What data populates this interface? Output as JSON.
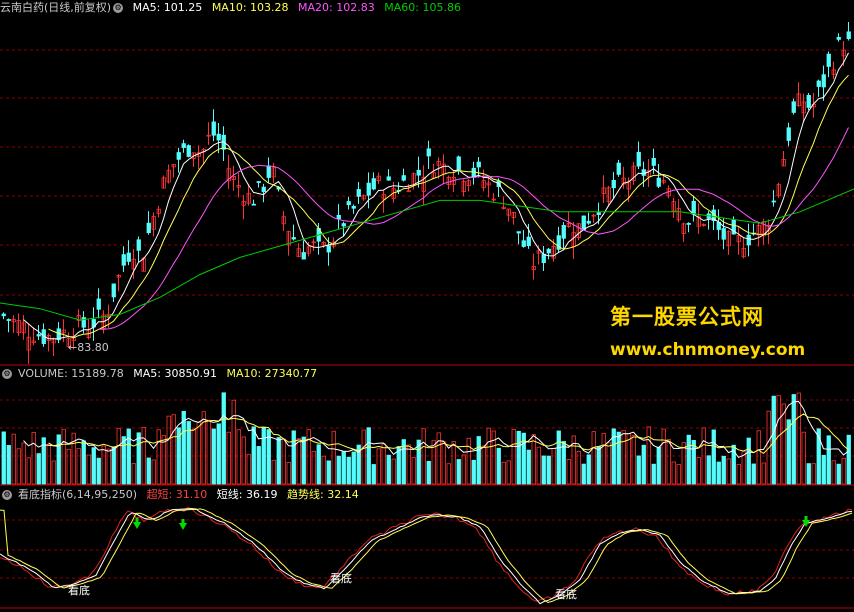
{
  "price_header": {
    "title": "云南白药(日线,前复权)",
    "ma5": "MA5: 101.25",
    "ma10": "MA10: 103.28",
    "ma20": "MA20: 102.83",
    "ma60": "MA60: 105.86"
  },
  "volume_header": {
    "title": "VOLUME: 15189.78",
    "ma5": "MA5: 30850.91",
    "ma10": "MA10: 27340.77"
  },
  "indicator_header": {
    "title": "看底指标(6,14,95,250)",
    "chao_label": "超短:",
    "chao_value": "31.10",
    "short_label": "短线:",
    "short_value": "36.19",
    "trend_label": "趋势线:",
    "trend_value": "32.14"
  },
  "low_marker": "83.80",
  "watermark": {
    "name": "第一股票公式网",
    "url": "www.chnmoney.com"
  },
  "bottom_marks": [
    "看底",
    "看底",
    "看底"
  ],
  "colors": {
    "up": "#ff3232",
    "down": "#54fcfc",
    "ma5": "#ffffff",
    "ma10": "#ffff55",
    "ma20": "#ff55ff",
    "ma60": "#00cc00",
    "grid": "#8b0000",
    "separator": "#c00000",
    "header_text": "#c8c8c8",
    "watermark": "#ffd700",
    "arrow": "#00dd00"
  },
  "chart_data": [
    {
      "type": "candlestick",
      "title": "云南白药(日线,前复权)",
      "series": [
        {
          "name": "MA5",
          "last": 101.25
        },
        {
          "name": "MA10",
          "last": 103.28
        },
        {
          "name": "MA20",
          "last": 102.83
        },
        {
          "name": "MA60",
          "last": 105.86
        }
      ],
      "annotations": [
        "83.80"
      ],
      "close_path": [
        [
          0,
          88
        ],
        [
          10,
          87
        ],
        [
          20,
          86
        ],
        [
          30,
          85
        ],
        [
          45,
          84
        ],
        [
          55,
          84.5
        ],
        [
          65,
          85
        ],
        [
          75,
          86
        ],
        [
          85,
          86
        ],
        [
          95,
          87
        ],
        [
          105,
          88
        ],
        [
          112,
          92
        ],
        [
          120,
          96
        ],
        [
          130,
          100
        ],
        [
          140,
          98
        ],
        [
          150,
          104
        ],
        [
          160,
          110
        ],
        [
          170,
          114
        ],
        [
          180,
          116
        ],
        [
          190,
          118
        ],
        [
          200,
          116
        ],
        [
          210,
          120
        ],
        [
          220,
          118
        ],
        [
          230,
          112
        ],
        [
          240,
          110
        ],
        [
          250,
          108
        ],
        [
          260,
          110
        ],
        [
          270,
          114
        ],
        [
          280,
          106
        ],
        [
          290,
          102
        ],
        [
          300,
          99
        ],
        [
          310,
          100
        ],
        [
          320,
          99
        ],
        [
          330,
          101
        ],
        [
          340,
          104
        ],
        [
          350,
          106
        ],
        [
          360,
          108
        ],
        [
          370,
          110
        ],
        [
          380,
          111
        ],
        [
          390,
          110
        ],
        [
          400,
          111
        ],
        [
          410,
          112
        ],
        [
          420,
          113
        ],
        [
          430,
          115
        ],
        [
          440,
          114
        ],
        [
          450,
          114
        ],
        [
          460,
          113
        ],
        [
          470,
          113
        ],
        [
          480,
          112
        ],
        [
          490,
          110
        ],
        [
          500,
          109
        ],
        [
          510,
          106
        ],
        [
          520,
          101
        ],
        [
          530,
          97
        ],
        [
          540,
          98
        ],
        [
          550,
          100
        ],
        [
          560,
          102
        ],
        [
          570,
          104
        ],
        [
          580,
          103
        ],
        [
          590,
          106
        ],
        [
          600,
          108
        ],
        [
          610,
          110
        ],
        [
          620,
          111
        ],
        [
          630,
          112
        ],
        [
          640,
          113
        ],
        [
          650,
          113
        ],
        [
          660,
          112
        ],
        [
          670,
          110
        ],
        [
          680,
          106
        ],
        [
          690,
          104
        ],
        [
          700,
          105
        ],
        [
          710,
          104
        ],
        [
          720,
          102
        ],
        [
          730,
          100
        ],
        [
          740,
          101
        ],
        [
          750,
          102
        ],
        [
          760,
          103
        ],
        [
          770,
          106
        ],
        [
          780,
          114
        ],
        [
          790,
          122
        ],
        [
          800,
          126
        ],
        [
          810,
          124
        ],
        [
          820,
          128
        ],
        [
          830,
          132
        ],
        [
          840,
          136
        ],
        [
          850,
          135
        ]
      ],
      "ma60_path": [
        [
          0,
          90
        ],
        [
          40,
          89
        ],
        [
          80,
          87
        ],
        [
          120,
          88
        ],
        [
          160,
          91
        ],
        [
          200,
          95
        ],
        [
          240,
          98
        ],
        [
          280,
          100
        ],
        [
          320,
          102
        ],
        [
          360,
          104
        ],
        [
          400,
          106
        ],
        [
          440,
          108
        ],
        [
          480,
          108
        ],
        [
          520,
          107
        ],
        [
          560,
          106
        ],
        [
          600,
          106
        ],
        [
          640,
          106
        ],
        [
          680,
          106
        ],
        [
          720,
          105
        ],
        [
          760,
          104
        ],
        [
          800,
          106
        ],
        [
          854,
          110
        ]
      ]
    },
    {
      "type": "bar",
      "title": "VOLUME",
      "series": [
        {
          "name": "VOLUME",
          "last": 15189.78
        },
        {
          "name": "MA5",
          "last": 30850.91
        },
        {
          "name": "MA10",
          "last": 27340.77
        }
      ]
    },
    {
      "type": "line",
      "title": "看底指标(6,14,95,250)",
      "series": [
        {
          "name": "超短",
          "last": 31.1
        },
        {
          "name": "短线",
          "last": 36.19
        },
        {
          "name": "趋势线",
          "last": 32.14
        }
      ],
      "path": [
        [
          0,
          35
        ],
        [
          30,
          45
        ],
        [
          55,
          58
        ],
        [
          75,
          55
        ],
        [
          95,
          50
        ],
        [
          115,
          25
        ],
        [
          130,
          6
        ],
        [
          150,
          12
        ],
        [
          170,
          5
        ],
        [
          195,
          4
        ],
        [
          225,
          14
        ],
        [
          255,
          28
        ],
        [
          285,
          48
        ],
        [
          305,
          55
        ],
        [
          325,
          58
        ],
        [
          345,
          45
        ],
        [
          370,
          26
        ],
        [
          395,
          18
        ],
        [
          420,
          10
        ],
        [
          440,
          8
        ],
        [
          460,
          10
        ],
        [
          480,
          16
        ],
        [
          500,
          38
        ],
        [
          520,
          55
        ],
        [
          540,
          68
        ],
        [
          560,
          63
        ],
        [
          580,
          52
        ],
        [
          600,
          28
        ],
        [
          620,
          20
        ],
        [
          640,
          18
        ],
        [
          660,
          22
        ],
        [
          680,
          40
        ],
        [
          700,
          52
        ],
        [
          730,
          62
        ],
        [
          760,
          60
        ],
        [
          775,
          52
        ],
        [
          790,
          30
        ],
        [
          805,
          14
        ],
        [
          830,
          10
        ],
        [
          854,
          5
        ]
      ],
      "ylim": [
        0,
        70
      ]
    }
  ]
}
